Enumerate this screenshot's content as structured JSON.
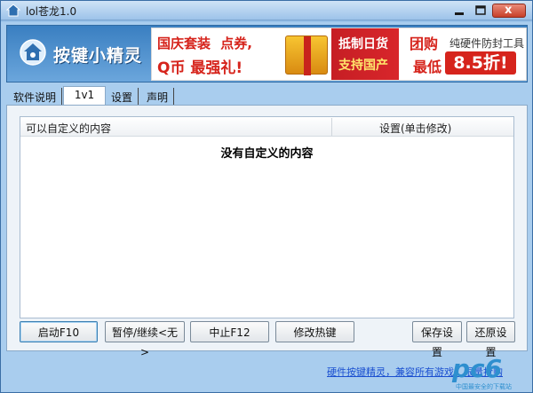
{
  "window": {
    "title": "lol苍龙1.0",
    "controls": {
      "minimize": "—",
      "maximize": "□",
      "close": "x"
    }
  },
  "header": {
    "logo_text": "按键小精灵",
    "banner": {
      "promo_line1": "国庆套装",
      "promo_line1b": "点券,",
      "promo_line2": "Q币 最强礼!",
      "middle_line1": "抵制日货",
      "middle_line2": "支持国产",
      "right_line1": "团购",
      "right_line1b": "纯硬件防封工具",
      "right_line2": "最低",
      "right_price": "8.5折!"
    }
  },
  "tabs": [
    {
      "label": "软件说明",
      "active": false
    },
    {
      "label": "1v1",
      "active": true
    },
    {
      "label": "设置",
      "active": false
    },
    {
      "label": "声明",
      "active": false
    }
  ],
  "list": {
    "columns": [
      "可以自定义的内容",
      "设置(单击修改)"
    ],
    "empty_message": "没有自定义的内容"
  },
  "buttons": {
    "start": "启动F10",
    "pause": "暂停/继续<无>",
    "stop": "中止F12",
    "hotkey": "修改热键",
    "save": "保存设置",
    "restore": "还原设置"
  },
  "footer": {
    "link_text": "硬件按键精灵，兼容所有游戏，限量抢购",
    "watermark": "pc6",
    "watermark_sub": "中国最安全的下载站"
  },
  "colors": {
    "window_blue": "#6fa8dc",
    "banner_red": "#d6241c",
    "link_blue": "#1a4fd0"
  }
}
